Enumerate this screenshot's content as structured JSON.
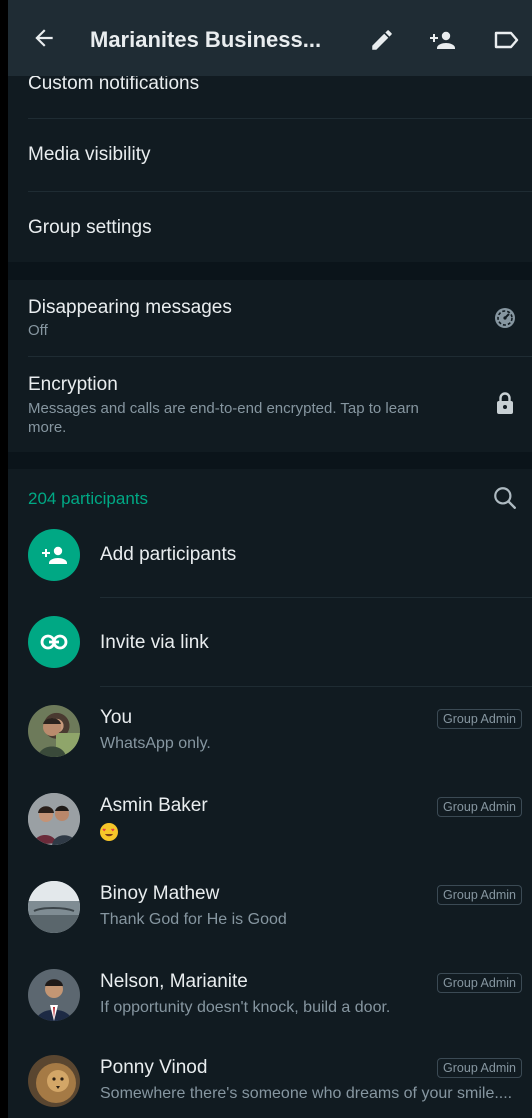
{
  "header": {
    "title": "Marianites Business...",
    "icons": [
      "back-arrow-icon",
      "edit-pencil-icon",
      "add-person-icon",
      "label-tag-icon"
    ]
  },
  "settings": {
    "custom_notifications": "Custom notifications",
    "media_visibility": "Media visibility",
    "group_settings": "Group settings"
  },
  "privacy": {
    "disappearing": {
      "title": "Disappearing messages",
      "value": "Off"
    },
    "encryption": {
      "title": "Encryption",
      "line1": "Messages and calls are end-to-end encrypted. Tap to learn",
      "line2": "more."
    }
  },
  "participants": {
    "count_label": "204 participants",
    "add_label": "Add participants",
    "invite_label": "Invite via link",
    "list": [
      {
        "name": "You",
        "status": "WhatsApp only.",
        "badge": "Group Admin"
      },
      {
        "name": "Asmin Baker",
        "status": "😍",
        "badge": "Group Admin"
      },
      {
        "name": "Binoy Mathew",
        "status": "Thank God for He is Good",
        "badge": "Group Admin"
      },
      {
        "name": "Nelson, Marianite",
        "status": "If opportunity doesn't knock, build a door.",
        "badge": "Group Admin"
      },
      {
        "name": "Ponny Vinod",
        "status": "Somewhere there's someone who dreams of your smile....",
        "badge": "Group Admin"
      }
    ]
  },
  "colors": {
    "background": "#111b21",
    "appbar": "#1f2c34",
    "section_gap": "#0b141a",
    "accent": "#00a884",
    "primary_text": "#e9edef",
    "secondary_text": "#8696a0"
  }
}
